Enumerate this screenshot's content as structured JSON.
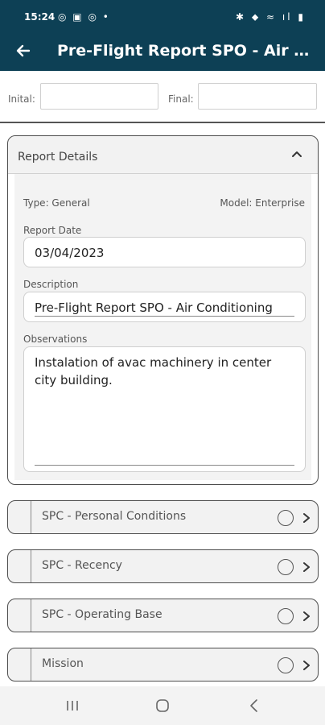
{
  "status_bar": {
    "time": "15:24",
    "notification_icons": "◎ ▣ ◎ •",
    "system_icons": "✱ ⬥ ≈ ıl ▮"
  },
  "app_bar": {
    "title": "Pre-Flight Report SPO - Air Co..."
  },
  "counters": {
    "initial_label": "Inital:",
    "final_label": "Final:",
    "initial_value": "",
    "final_value": ""
  },
  "report_details": {
    "header": "Report Details",
    "type": "Type: General",
    "model": "Model: Enterprise",
    "report_date_label": "Report Date",
    "report_date": "03/04/2023",
    "description_label": "Description",
    "description": "Pre-Flight Report SPO - Air Conditioning",
    "observations_label": "Observations",
    "observations": "Instalation of avac machinery in center city building."
  },
  "sections": [
    {
      "label": "SPC - Personal Conditions"
    },
    {
      "label": "SPC - Recency"
    },
    {
      "label": "SPC - Operating Base"
    },
    {
      "label": "Mission"
    }
  ],
  "colors": {
    "app_bar": "#0d4055",
    "panel_border": "#4d4d4d",
    "panel_bg": "#f2f2f2"
  }
}
